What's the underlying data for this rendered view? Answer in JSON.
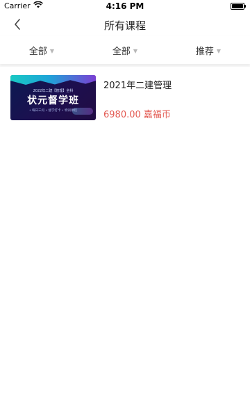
{
  "status_bar": {
    "carrier": "Carrier",
    "time": "4:16 PM"
  },
  "nav": {
    "title": "所有课程"
  },
  "filters": [
    {
      "label": "全部"
    },
    {
      "label": "全部"
    },
    {
      "label": "推荐"
    }
  ],
  "courses": [
    {
      "title": "2021年二建管理",
      "price": "6980.00 嘉福币",
      "thumbnail": {
        "top_text": "2022年二建【管理】全科",
        "title": "状元督学班",
        "sub_text": "• 每日三问  • 督学打卡  • 特训课程"
      }
    }
  ],
  "colors": {
    "price": "#e35a52",
    "background": "#f7f7f7"
  }
}
